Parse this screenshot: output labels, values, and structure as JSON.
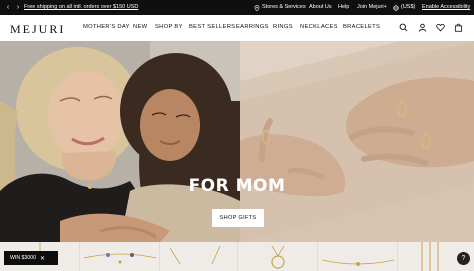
{
  "promo": {
    "text": "Free shipping on all intl. orders over $150 USD",
    "stores": "Stores & Services",
    "about": "About Us",
    "help": "Help",
    "join": "Join Mejuri+",
    "region": "(US$)",
    "accessibility": "Enable Accessibility"
  },
  "nav": {
    "logo": "MEJURI",
    "items": [
      "MOTHER'S DAY",
      "NEW",
      "SHOP BY",
      "BEST SELLERS",
      "EARRINGS",
      "RINGS",
      "NECKLACES",
      "BRACELETS"
    ]
  },
  "hero": {
    "title": "FOR MOM",
    "cta": "SHOP GIFTS"
  },
  "widgets": {
    "win": "WIN $3000",
    "help": "?"
  },
  "colors": {
    "promo_bg": "#0f0f0f",
    "cta_bg": "#ffffff",
    "win_bg": "#0d0d0d"
  },
  "icons": [
    "chevron-left-icon",
    "chevron-right-icon",
    "location-pin-icon",
    "globe-icon",
    "search-icon",
    "user-icon",
    "heart-icon",
    "bag-icon",
    "close-icon"
  ]
}
